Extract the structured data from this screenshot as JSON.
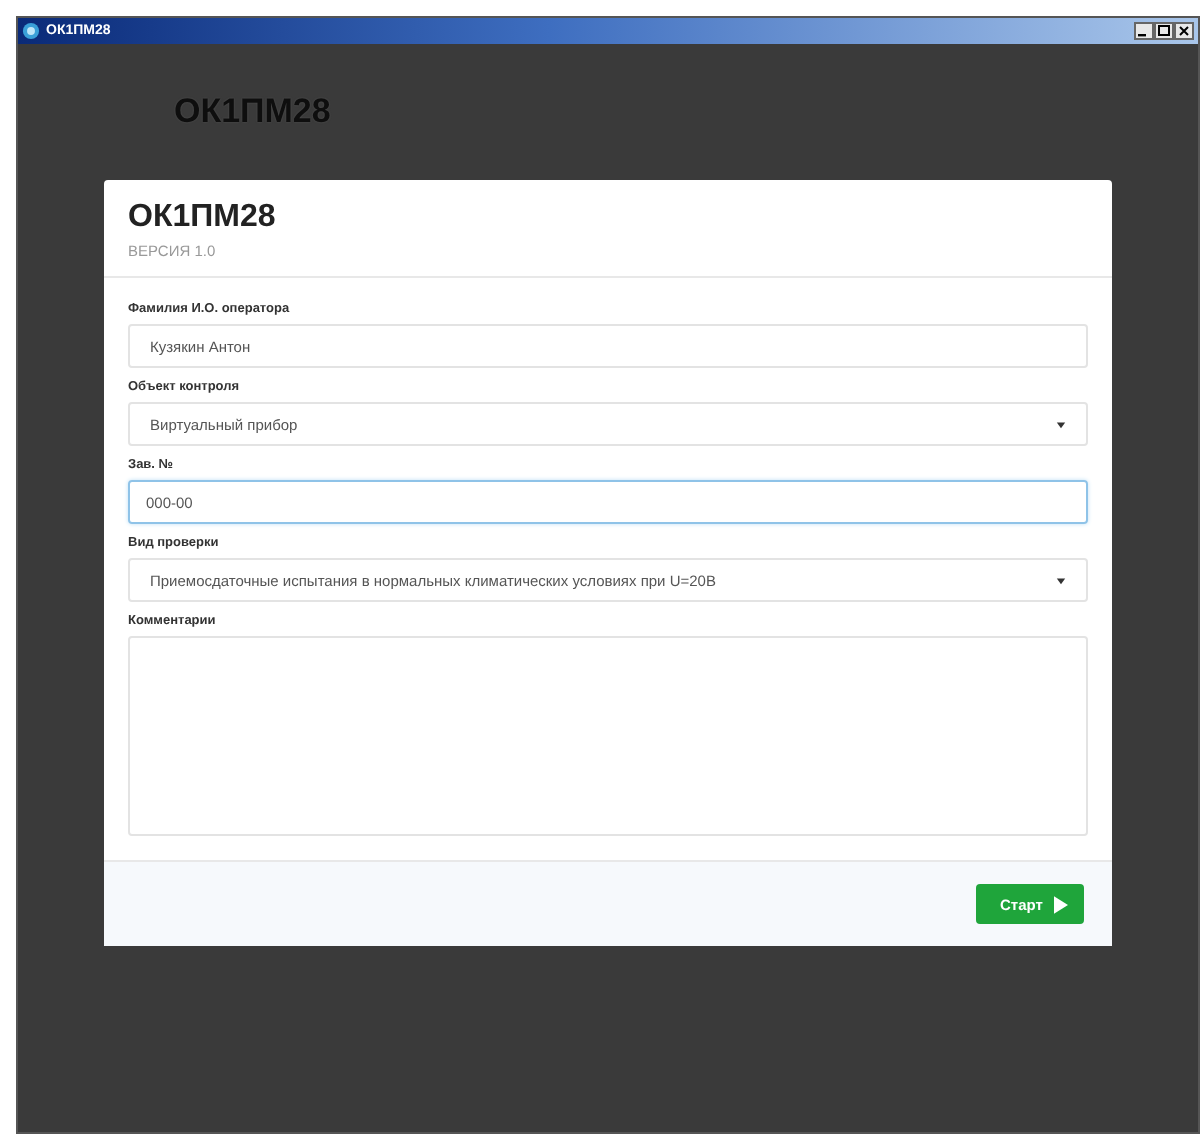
{
  "window": {
    "title": "ОК1ПМ28"
  },
  "background_title": "ОК1ПМ28",
  "modal": {
    "title": "ОК1ПМ28",
    "subtitle": "ВЕРСИЯ 1.0",
    "fields": [
      {
        "kind": "input",
        "label": "Фамилия И.О. оператора",
        "value": "Кузякин Антон",
        "focused": false
      },
      {
        "kind": "select",
        "label": "Объект контроля",
        "value": "Виртуальный прибор",
        "focused": false
      },
      {
        "kind": "input",
        "label": "Зав. №",
        "value": "000-00",
        "focused": true
      },
      {
        "kind": "select",
        "label": "Вид проверки",
        "value": "Приемосдаточные испытания в нормальных климатических условиях при U=20В",
        "focused": false
      },
      {
        "kind": "textarea",
        "label": "Комментарии",
        "focused": false
      }
    ],
    "start_button": "Старт"
  }
}
